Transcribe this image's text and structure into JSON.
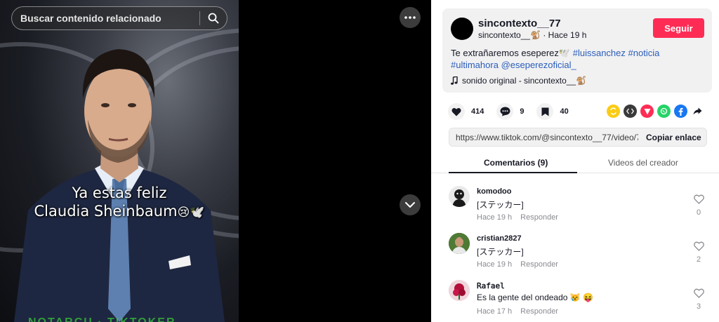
{
  "search": {
    "placeholder": "Buscar contenido relacionado"
  },
  "video": {
    "caption_line1": "Ya estas feliz",
    "caption_line2": "Claudia Sheinbaum",
    "caption_emoji": "😢🕊️",
    "ticker_text": "NOTARCU · TIKTOKER"
  },
  "post": {
    "author_name": "sincontexto__77",
    "author_handle": "sincontexto__🐒",
    "time": "Hace 19 h",
    "follow_label": "Seguir",
    "description_text": "Te extrañaremos eseperez🕊️",
    "hashtags": [
      "#luissanchez",
      "#noticia",
      "#ultimahora",
      "@eseperezoficial_"
    ],
    "music": "sonido original - sincontexto__🐒"
  },
  "actions": {
    "likes": "414",
    "comments": "9",
    "saves": "40"
  },
  "link": {
    "url": "https://www.tiktok.com/@sincontexto__77/video/7...",
    "copy_label": "Copiar enlace"
  },
  "tabs": {
    "comments": "Comentarios (9)",
    "videos": "Videos del creador"
  },
  "comments": [
    {
      "user": "komodoo",
      "text": "[ステッカー]",
      "time": "Hace 19 h",
      "reply": "Responder",
      "likes": "0"
    },
    {
      "user": "cristian2827",
      "text": "[ステッカー]",
      "time": "Hace 19 h",
      "reply": "Responder",
      "likes": "2"
    },
    {
      "user": "𝚁𝚊𝚏𝚊𝚎𝚕",
      "text": "Es la gente del ondeado 😿 😝",
      "time": "Hace 17 h",
      "reply": "Responder",
      "likes": "3"
    }
  ],
  "colors": {
    "accent": "#fe2c55",
    "hashtag": "#2b5db9",
    "panel_bg": "#ffffff",
    "card_bg": "#f1f1f2"
  }
}
